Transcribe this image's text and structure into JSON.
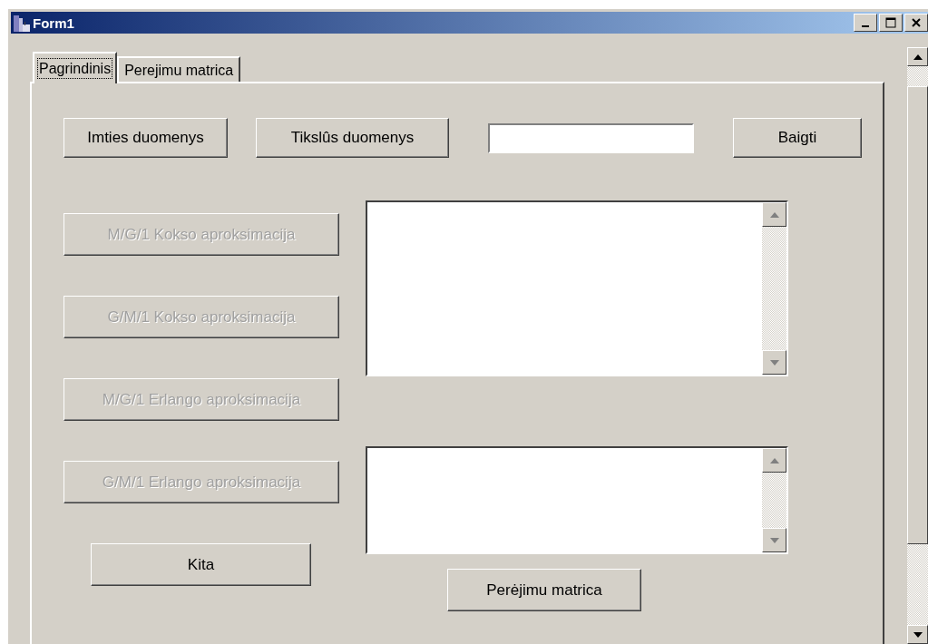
{
  "window": {
    "title": "Form1"
  },
  "tabs": [
    {
      "label": "Pagrindinis",
      "selected": true
    },
    {
      "label": "Perejimu matrica",
      "selected": false
    }
  ],
  "top_row": [
    {
      "kind": "button",
      "label": "Imties duomenys",
      "disabled": false
    },
    {
      "kind": "button",
      "label": "Tikslûs duomenys",
      "disabled": false
    },
    {
      "kind": "field"
    },
    {
      "kind": "button",
      "label": "Baigti",
      "disabled": false
    }
  ],
  "approximation_buttons": [
    {
      "label": "M/G/1 Kokso aproksimacija",
      "disabled": true
    },
    {
      "label": "G/M/1 Kokso aproksimacija",
      "disabled": true
    },
    {
      "label": "M/G/1 Erlango aproksimacija",
      "disabled": true
    },
    {
      "label": "G/M/1 Erlango aproksimacija",
      "disabled": true
    }
  ],
  "other_button": {
    "label": "Kita",
    "disabled": false
  },
  "transition_button": {
    "label": "Perėjimu matrica",
    "disabled": false
  }
}
